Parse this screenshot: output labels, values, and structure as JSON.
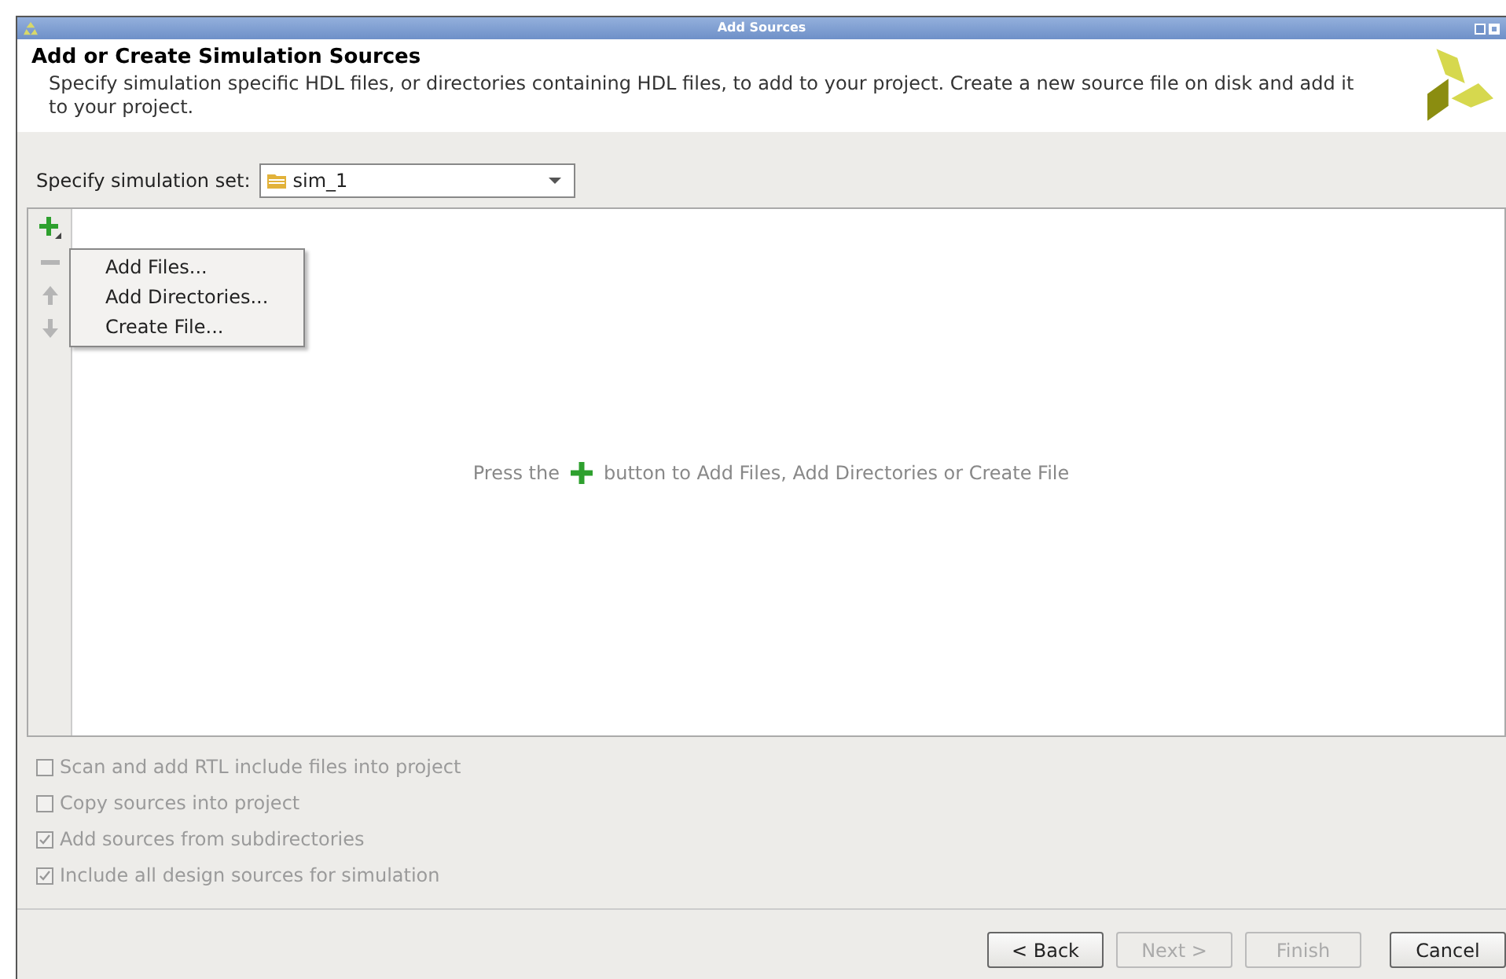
{
  "window": {
    "title": "Add Sources"
  },
  "header": {
    "title": "Add or Create Simulation Sources",
    "description": "Specify simulation specific HDL files, or directories containing HDL files, to add to your project. Create a new source file on disk and add it to your project."
  },
  "simulation_set": {
    "label": "Specify simulation set:",
    "value": "sim_1"
  },
  "toolbar": [
    {
      "kind": "add",
      "disabled": false
    },
    {
      "kind": "remove",
      "disabled": true
    },
    {
      "kind": "up",
      "disabled": true
    },
    {
      "kind": "down",
      "disabled": true
    }
  ],
  "menu": {
    "items": [
      "Add Files...",
      "Add Directories...",
      "Create File..."
    ]
  },
  "hint": {
    "before": "Press the",
    "after": "button to Add Files, Add Directories or Create File"
  },
  "options": [
    {
      "label": "Scan and add RTL include files into project",
      "checked": false,
      "disabled": true
    },
    {
      "label": "Copy sources into project",
      "checked": false,
      "disabled": true
    },
    {
      "label": "Add sources from subdirectories",
      "checked": true,
      "disabled": true
    },
    {
      "label": "Include all design sources for simulation",
      "checked": true,
      "disabled": true
    }
  ],
  "buttons": [
    {
      "label": "< Back",
      "disabled": false
    },
    {
      "label": "Next >",
      "disabled": true
    },
    {
      "label": "Finish",
      "disabled": true
    },
    {
      "label": "Cancel",
      "disabled": false
    }
  ]
}
